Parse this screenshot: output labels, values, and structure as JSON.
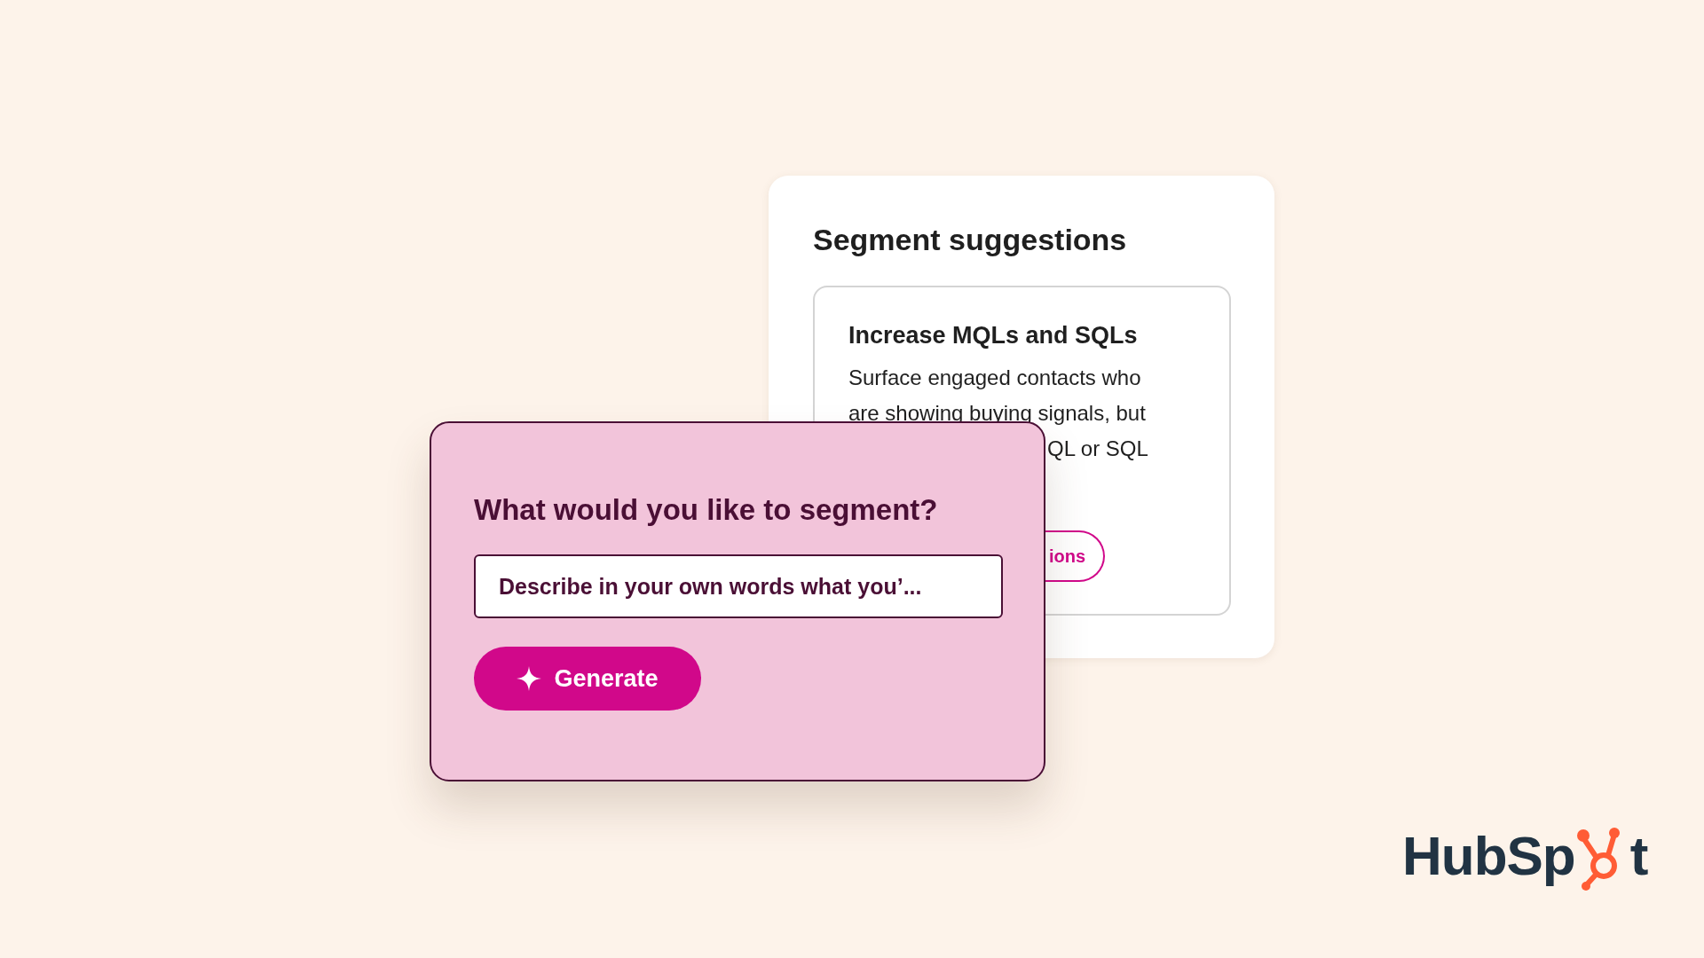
{
  "back_card": {
    "title": "Segment suggestions",
    "suggestion": {
      "title": "Increase MQLs and SQLs",
      "lines": [
        "Surface engaged contacts who",
        "are showing buying signals, but"
      ],
      "line_tail": "QL or SQL",
      "button_tail": "ions"
    }
  },
  "front_card": {
    "question": "What would you like to segment?",
    "input": {
      "placeholder": "Describe in your own words what you’..."
    },
    "button": {
      "label": "Generate"
    }
  },
  "logo": {
    "text_start": "HubSp",
    "text_end": "t"
  }
}
